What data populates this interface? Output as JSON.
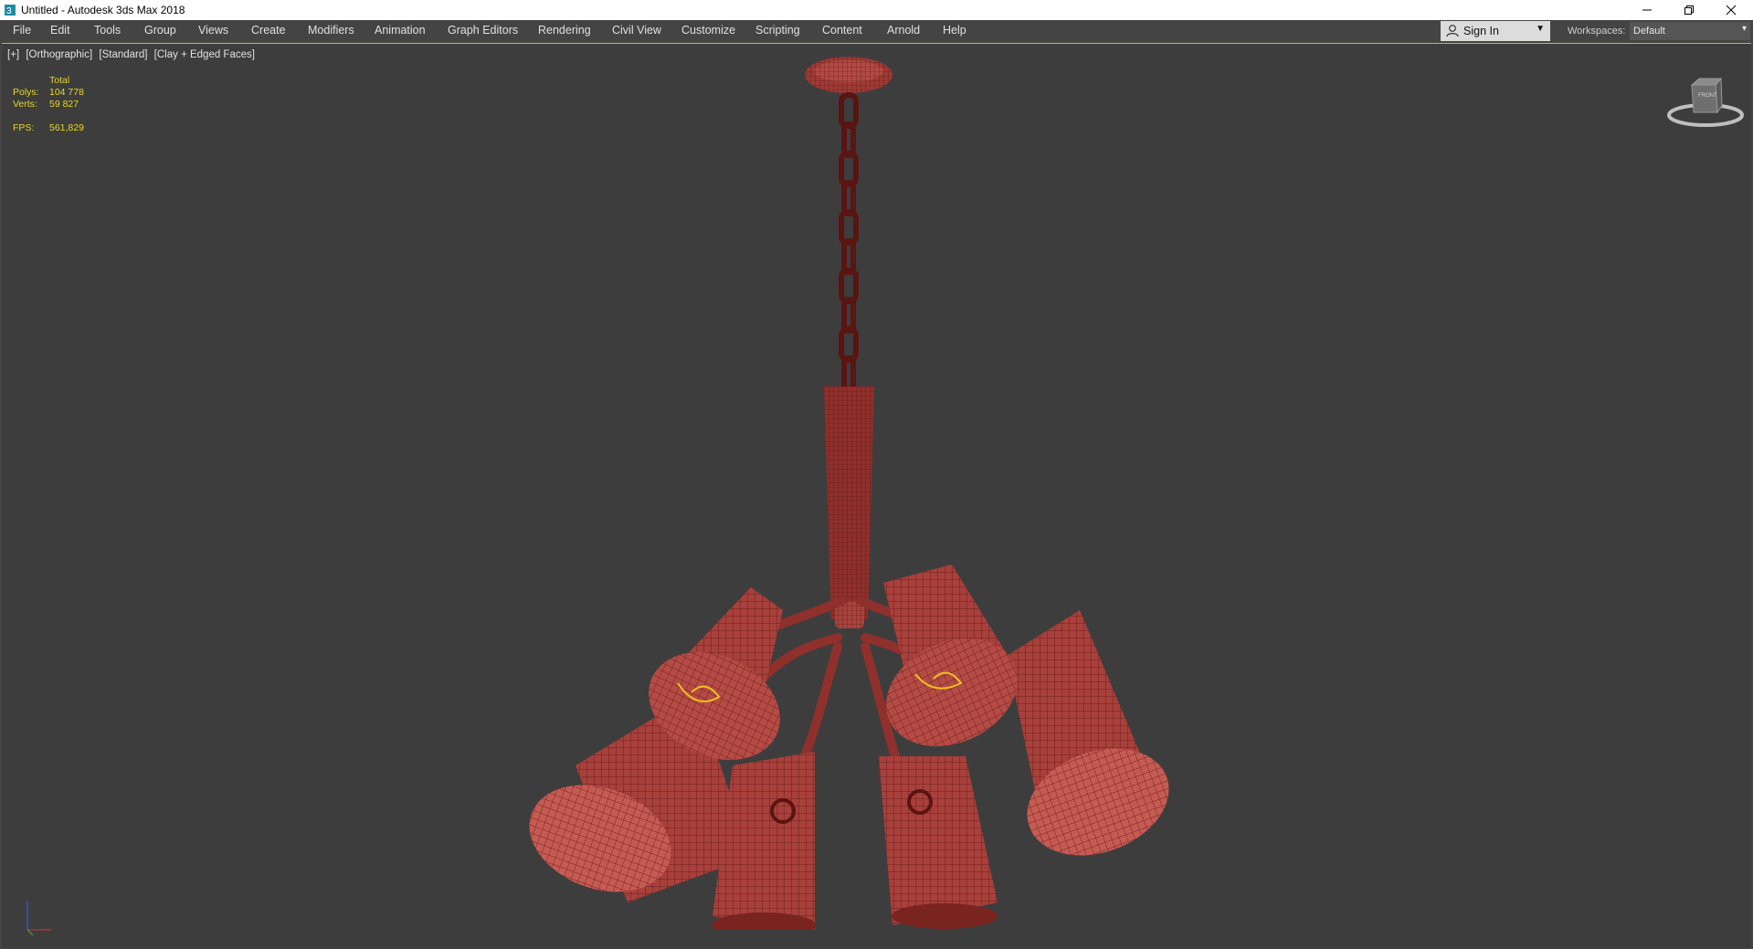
{
  "window": {
    "title": "Untitled - Autodesk 3ds Max 2018",
    "controls": [
      "minimize",
      "restore",
      "close"
    ]
  },
  "menu": {
    "items": [
      "File",
      "Edit",
      "Tools",
      "Group",
      "Views",
      "Create",
      "Modifiers",
      "Animation",
      "Graph Editors",
      "Rendering",
      "Civil View",
      "Customize",
      "Scripting",
      "Content",
      "Arnold",
      "Help"
    ]
  },
  "account": {
    "signin_label": "Sign In"
  },
  "workspaces": {
    "label": "Workspaces:",
    "value": "Default"
  },
  "viewport": {
    "labels": [
      "[+]",
      "[Orthographic]",
      "[Standard]",
      "[Clay + Edged Faces]"
    ],
    "stats": {
      "header": "Total",
      "polys_label": "Polys:",
      "polys_value": "104 778",
      "verts_label": "Verts:",
      "verts_value": "59 827",
      "fps_label": "FPS:",
      "fps_value": "561,829"
    },
    "viewcube_face": "FRONT"
  },
  "colors": {
    "accent": "#e8b400",
    "stats_text": "#e8d81e",
    "model": "#b24a44",
    "wire": "#5a1412",
    "viewport_bg": "#3d3d3d"
  }
}
